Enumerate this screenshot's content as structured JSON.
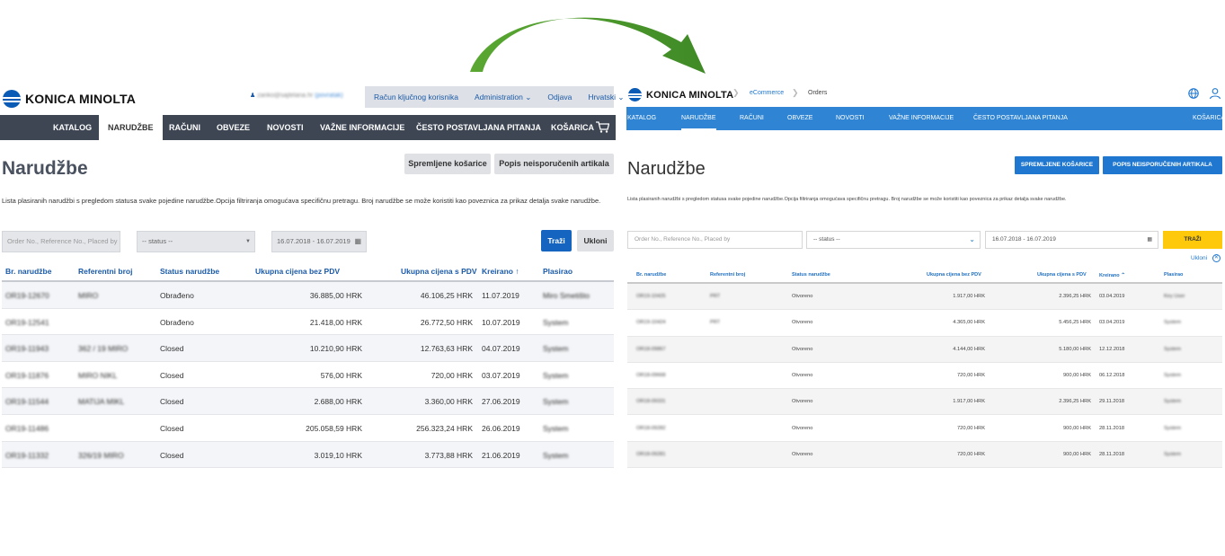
{
  "old": {
    "brand": "KONICA MINOLTA",
    "user_email": "zanko@sajtelana.hr",
    "user_role": "(povratak)",
    "top_menu": [
      "Račun ključnog korisnika",
      "Administration ⌄",
      "Odjava",
      "Hrvatski ⌄"
    ],
    "nav": [
      "KATALOG",
      "NARUDŽBE",
      "RAČUNI",
      "OBVEZE",
      "NOVOSTI",
      "VAŽNE INFORMACIJE",
      "ČESTO POSTAVLJANA PITANJA",
      "KOŠARICA"
    ],
    "nav_active": "NARUDŽBE",
    "title": "Narudžbe",
    "btn_saved_carts": "Spremljene košarice",
    "btn_unshipped": "Popis neisporučenih artikala",
    "description": "Lista plasiranih narudžbi s pregledom statusa svake pojedine narudžbe.Opcija filtriranja omogućava specifičnu pretragu. Broj narudžbe se može koristiti kao poveznica za prikaz detalja svake narudžbe.",
    "search_placeholder": "Order No., Reference No., Placed by",
    "status_select": "-- status --",
    "date_range": "16.07.2018 - 16.07.2019",
    "btn_search": "Traži",
    "btn_clear": "Ukloni",
    "columns": [
      "Br. narudžbe",
      "Referentni broj",
      "Status narudžbe",
      "Ukupna cijena bez PDV",
      "Ukupna cijena s PDV",
      "Kreirano ↑",
      "Plasirao"
    ],
    "rows": [
      {
        "order": "OR19-12670",
        "ref": "MIRO",
        "status": "Obrađeno",
        "net": "36.885,00 HRK",
        "gross": "46.106,25 HRK",
        "created": "11.07.2019",
        "placed_by": "Miro Smetišto"
      },
      {
        "order": "OR19-12541",
        "ref": "",
        "status": "Obrađeno",
        "net": "21.418,00 HRK",
        "gross": "26.772,50 HRK",
        "created": "10.07.2019",
        "placed_by": "System"
      },
      {
        "order": "OR19-11943",
        "ref": "362 / 19 MIRO",
        "status": "Closed",
        "net": "10.210,90 HRK",
        "gross": "12.763,63 HRK",
        "created": "04.07.2019",
        "placed_by": "System"
      },
      {
        "order": "OR19-11876",
        "ref": "MIRO NIKL",
        "status": "Closed",
        "net": "576,00 HRK",
        "gross": "720,00 HRK",
        "created": "03.07.2019",
        "placed_by": "System"
      },
      {
        "order": "OR19-11544",
        "ref": "MATIJA MIKL",
        "status": "Closed",
        "net": "2.688,00 HRK",
        "gross": "3.360,00 HRK",
        "created": "27.06.2019",
        "placed_by": "System"
      },
      {
        "order": "OR19-11486",
        "ref": "",
        "status": "Closed",
        "net": "205.058,59 HRK",
        "gross": "256.323,24 HRK",
        "created": "26.06.2019",
        "placed_by": "System"
      },
      {
        "order": "OR19-11332",
        "ref": "326/19 MIRO",
        "status": "Closed",
        "net": "3.019,10 HRK",
        "gross": "3.773,88 HRK",
        "created": "21.06.2019",
        "placed_by": "System"
      }
    ]
  },
  "new": {
    "brand": "KONICA MINOLTA",
    "breadcrumb": [
      "eCommerce",
      "Orders"
    ],
    "nav": [
      "KATALOG",
      "NARUDŽBE",
      "RAČUNI",
      "OBVEZE",
      "NOVOSTI",
      "VAŽNE INFORMACIJE",
      "ČESTO POSTAVLJANA PITANJA",
      "KOŠARICA"
    ],
    "nav_active": "NARUDŽBE",
    "title": "Narudžbe",
    "btn_saved_carts": "SPREMLJENE KOŠARICE",
    "btn_unshipped": "POPIS NEISPORUČENIH ARTIKALA",
    "description": "Lista plasiranih narudžbi s pregledom statusa svake pojedine narudžbe.Opcija filtriranja omogućava specifičnu pretragu. Broj narudžbe se može koristiti kao poveznica za prikaz detalja svake narudžbe.",
    "search_placeholder": "Order No., Reference No., Placed by",
    "status_select": "-- status --",
    "date_range": "16.07.2018 - 16.07.2019",
    "btn_search": "TRAŽI",
    "btn_clear": "Ukloni",
    "columns": [
      "Br. narudžbe",
      "Referentni broj",
      "Status narudžbe",
      "Ukupna cijena bez PDV",
      "Ukupna cijena s PDV",
      "Kreirano",
      "Plasirao"
    ],
    "rows": [
      {
        "order": "OR19-10425",
        "ref": "PRT",
        "status": "Otvoreno",
        "net": "1.917,00 HRK",
        "gross": "2.396,25 HRK",
        "created": "03.04.2019",
        "placed_by": "Key User"
      },
      {
        "order": "OR19-10424",
        "ref": "PRT",
        "status": "Otvoreno",
        "net": "4.365,00 HRK",
        "gross": "5.456,25 HRK",
        "created": "03.04.2019",
        "placed_by": "System"
      },
      {
        "order": "OR18-09867",
        "ref": "",
        "status": "Otvoreno",
        "net": "4.144,00 HRK",
        "gross": "5.180,00 HRK",
        "created": "12.12.2018",
        "placed_by": "System"
      },
      {
        "order": "OR18-09668",
        "ref": "",
        "status": "Otvoreno",
        "net": "720,00 HRK",
        "gross": "900,00 HRK",
        "created": "06.12.2018",
        "placed_by": "System"
      },
      {
        "order": "OR18-09331",
        "ref": "",
        "status": "Otvoreno",
        "net": "1.917,00 HRK",
        "gross": "2.396,25 HRK",
        "created": "29.11.2018",
        "placed_by": "System"
      },
      {
        "order": "OR18-09282",
        "ref": "",
        "status": "Otvoreno",
        "net": "720,00 HRK",
        "gross": "900,00 HRK",
        "created": "28.11.2018",
        "placed_by": "System"
      },
      {
        "order": "OR18-09281",
        "ref": "",
        "status": "Otvoreno",
        "net": "720,00 HRK",
        "gross": "900,00 HRK",
        "created": "28.11.2018",
        "placed_by": "System"
      }
    ]
  },
  "colors": {
    "old_nav": "#3e4654",
    "new_nav": "#2f85d3",
    "old_primary": "#1565c0",
    "new_search": "#fdc90a",
    "arrow": "#4f9a2c"
  }
}
